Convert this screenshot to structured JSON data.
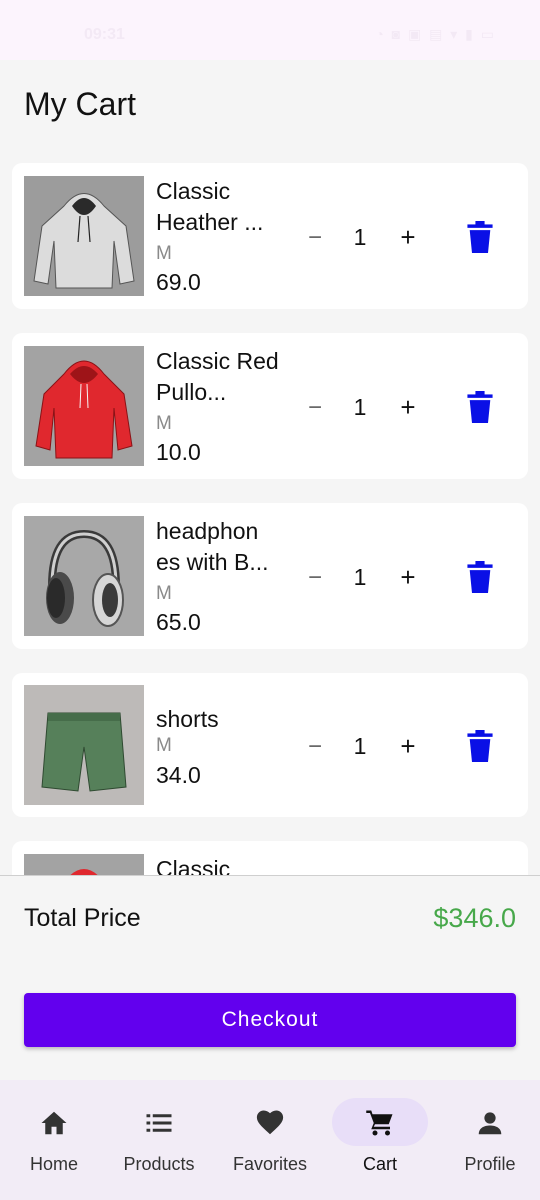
{
  "status_bar": {
    "time": "09:31",
    "icons": "◔ ◙ ▣ ▤ ▾ ▮ ▭"
  },
  "page": {
    "title": "My Cart"
  },
  "cart": {
    "items": [
      {
        "name": "Classic Heather ...",
        "size": "M",
        "price": "69.0",
        "quantity": "1",
        "image": "grey-hoodie"
      },
      {
        "name": "Classic Red Pullo...",
        "size": "M",
        "price": "10.0",
        "quantity": "1",
        "image": "red-hoodie"
      },
      {
        "name": "headphon es with B...",
        "size": "M",
        "price": "65.0",
        "quantity": "1",
        "image": "headphones"
      },
      {
        "name": "shorts",
        "size": "M",
        "price": "34.0",
        "quantity": "1",
        "image": "green-shorts"
      },
      {
        "name": "Classic",
        "size": "",
        "price": "",
        "quantity": "",
        "image": "red-hoodie"
      }
    ],
    "minus_symbol": "−",
    "plus_symbol": "+"
  },
  "summary": {
    "total_label": "Total Price",
    "total_value": "$346.0"
  },
  "checkout": {
    "label": "Checkout"
  },
  "bottom_nav": {
    "items": [
      {
        "label": "Home",
        "icon": "home-icon"
      },
      {
        "label": "Products",
        "icon": "list-icon"
      },
      {
        "label": "Favorites",
        "icon": "heart-icon"
      },
      {
        "label": "Cart",
        "icon": "cart-icon",
        "active": true
      },
      {
        "label": "Profile",
        "icon": "person-icon"
      }
    ]
  },
  "colors": {
    "accent": "#6200ee",
    "trash": "#0a10e6",
    "total": "#47a84a",
    "nav_active": "#e8def8"
  }
}
